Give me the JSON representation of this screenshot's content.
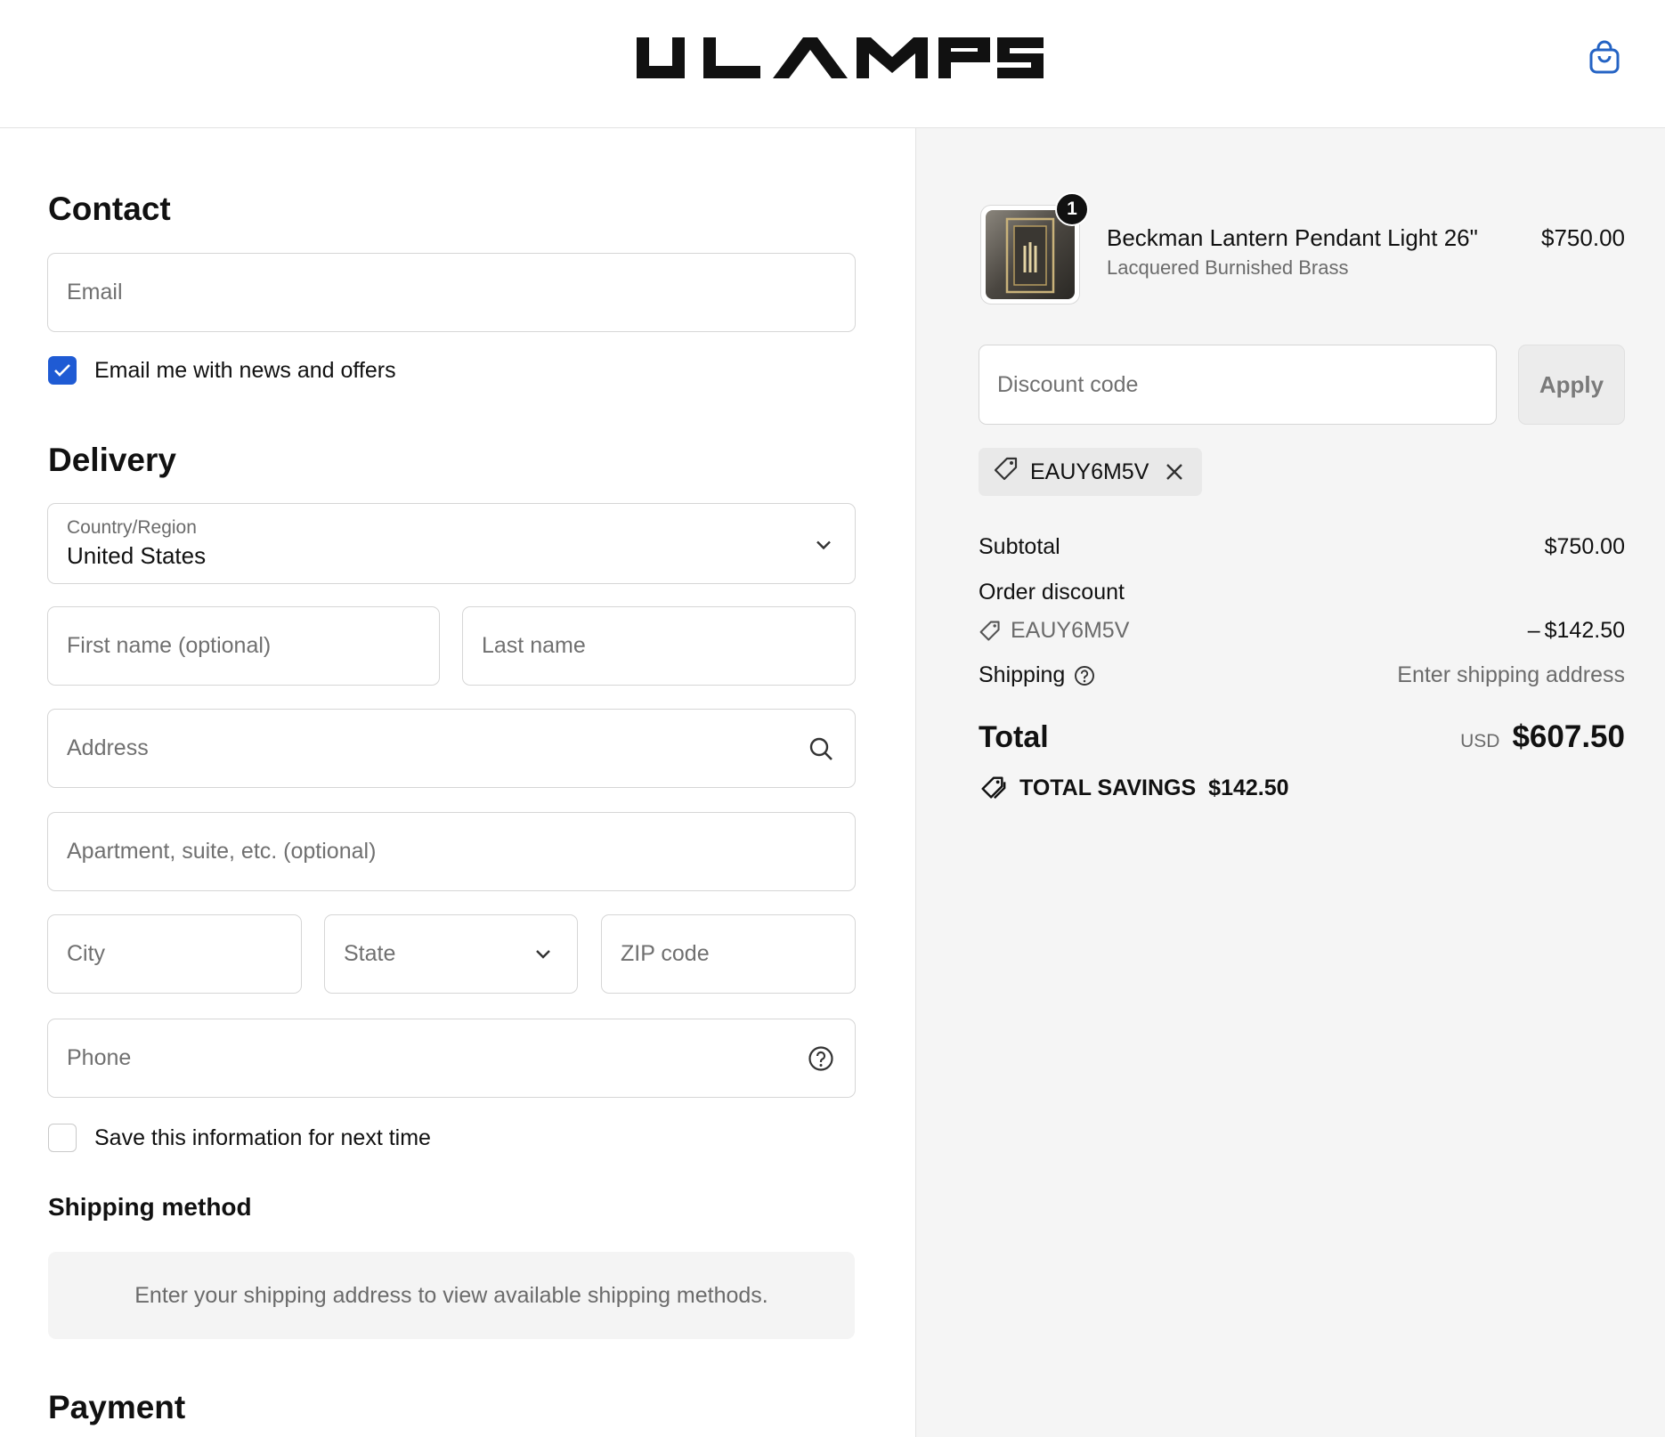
{
  "header": {
    "logo_text": "ULAMPS",
    "cart_icon": "shopping-bag-icon"
  },
  "contact": {
    "title": "Contact",
    "email_placeholder": "Email",
    "newsletter_label": "Email me with news and offers",
    "newsletter_checked": true
  },
  "delivery": {
    "title": "Delivery",
    "country_label": "Country/Region",
    "country_value": "United States",
    "first_name_placeholder": "First name (optional)",
    "last_name_placeholder": "Last name",
    "address_placeholder": "Address",
    "apartment_placeholder": "Apartment, suite, etc. (optional)",
    "city_placeholder": "City",
    "state_placeholder": "State",
    "zip_placeholder": "ZIP code",
    "phone_placeholder": "Phone",
    "save_info_label": "Save this information for next time",
    "save_info_checked": false
  },
  "shipping_method": {
    "title": "Shipping method",
    "notice": "Enter your shipping address to view available shipping methods."
  },
  "payment": {
    "title": "Payment"
  },
  "summary": {
    "item": {
      "quantity": "1",
      "name": "Beckman Lantern Pendant Light 26\"",
      "variant": "Lacquered Burnished Brass",
      "price": "$750.00"
    },
    "discount_placeholder": "Discount code",
    "apply_label": "Apply",
    "applied_code": "EAUY6M5V",
    "subtotal_label": "Subtotal",
    "subtotal_value": "$750.00",
    "order_discount_label": "Order discount",
    "discount_code": "EAUY6M5V",
    "discount_value": "– $142.50",
    "shipping_label": "Shipping",
    "shipping_value": "Enter shipping address",
    "total_label": "Total",
    "total_currency": "USD",
    "total_value": "$607.50",
    "savings_label": "TOTAL SAVINGS",
    "savings_value": "$142.50"
  },
  "colors": {
    "accent": "#1f5bd4",
    "cart_icon": "#2463c4",
    "text": "#111111",
    "muted": "#6b6b6b",
    "summary_bg": "#f5f5f5"
  }
}
